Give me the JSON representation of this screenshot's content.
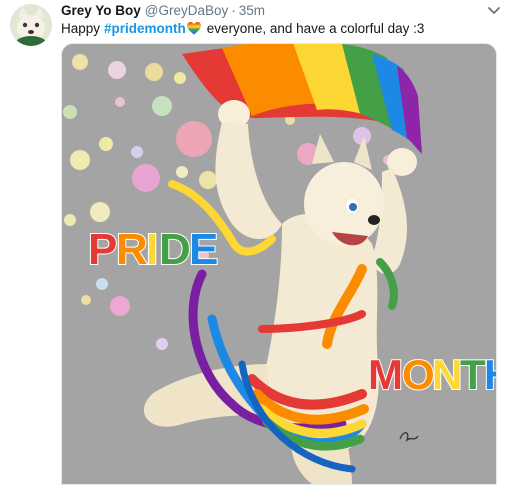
{
  "tweet": {
    "author_name": "Grey Yo Boy",
    "handle": "@GreyDaBoy",
    "separator": "·",
    "time": "35m",
    "text_before": "Happy",
    "hashtag": "#pridemonth",
    "text_after": "everyone, and have a colorful day :3",
    "emoji_icon": "rainbow-heart-icon",
    "caret_icon": "chevron-down-icon"
  },
  "media": {
    "word_top": "PRIDE",
    "word_bottom": "MONTH",
    "background_color": "#a4a4a4",
    "rainbow_colors": [
      "#e53935",
      "#fb8c00",
      "#fdd835",
      "#43a047",
      "#1e88e5",
      "#8e24aa"
    ]
  },
  "colors": {
    "link": "#1b95e0",
    "text": "#14171a",
    "muted": "#657786"
  }
}
